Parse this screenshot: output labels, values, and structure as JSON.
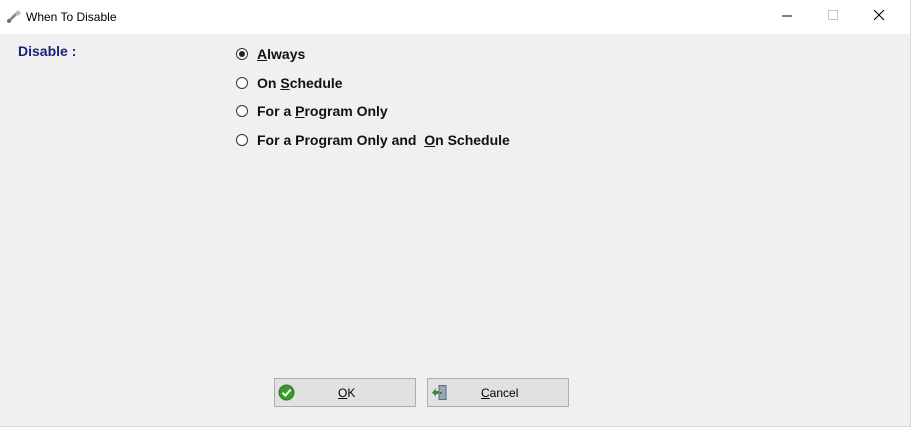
{
  "window": {
    "title": "When To Disable",
    "app_icon": "tool-icon",
    "controls": {
      "minimize_icon": "minimize-icon",
      "maximize_icon": "maximize-icon",
      "close_icon": "close-icon"
    }
  },
  "form": {
    "disable_label": "Disable :",
    "selected_option": "Always",
    "options": [
      {
        "pre": "",
        "accel": "A",
        "post": "lways",
        "selected": true
      },
      {
        "pre": "On ",
        "accel": "S",
        "post": "chedule",
        "selected": false
      },
      {
        "pre": "For a ",
        "accel": "P",
        "post": "rogram Only",
        "selected": false
      },
      {
        "pre": "For a Program Only and  ",
        "accel": "O",
        "post": "n Schedule",
        "selected": false
      }
    ]
  },
  "buttons": {
    "ok": {
      "accel": "O",
      "rest": "K",
      "icon": "check-circle-icon",
      "icon_color": "#3a9a2c"
    },
    "cancel": {
      "accel": "C",
      "rest": "ancel",
      "icon": "exit-door-icon",
      "icon_color": "#3d8a3a"
    }
  },
  "colors": {
    "label_color": "#1a1f7a",
    "dialog_background": "#f0f0f0",
    "button_face": "#e1e1e1"
  }
}
